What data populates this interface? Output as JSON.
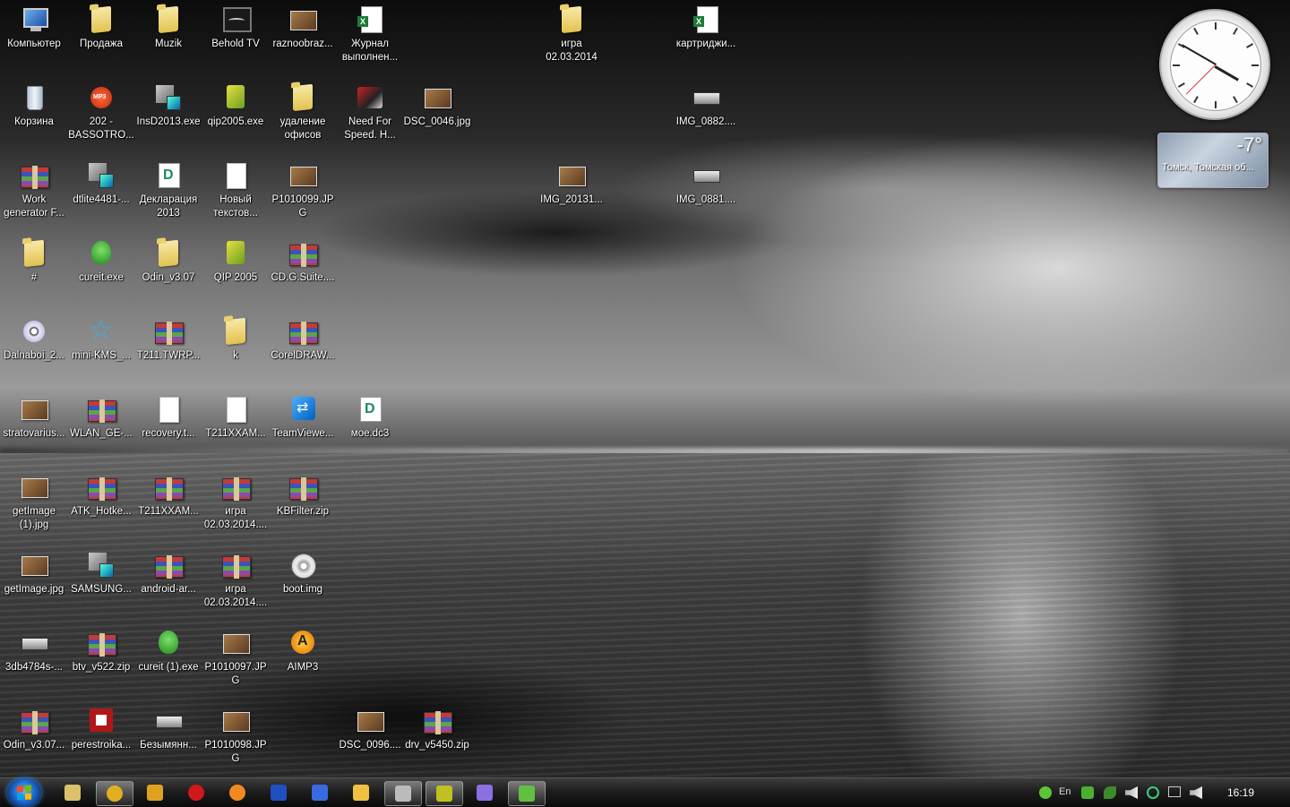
{
  "desktop": {
    "icons": [
      {
        "label": "Компьютер",
        "kind": "computer-icon"
      },
      {
        "label": "Продажа",
        "kind": "folder-icon"
      },
      {
        "label": "Muzik",
        "kind": "folder-icon"
      },
      {
        "label": "Behold TV",
        "kind": "tv-icon"
      },
      {
        "label": "raznoobraz...",
        "kind": "photo-icon"
      },
      {
        "label": "Журнал выполнен...",
        "kind": "excel-icon"
      },
      {
        "label": "игра 02.03.2014",
        "kind": "folder-icon"
      },
      {
        "label": "картриджи...",
        "kind": "excel-icon"
      },
      {
        "label": "Корзина",
        "kind": "recycle-bin-icon"
      },
      {
        "label": "202 - BASSOTRO...",
        "kind": "mp3-icon"
      },
      {
        "label": "InsD2013.exe",
        "kind": "setup-icon"
      },
      {
        "label": "qip2005.exe",
        "kind": "qip-icon"
      },
      {
        "label": "удаление офисов",
        "kind": "folder-icon"
      },
      {
        "label": "Need For Speed. H...",
        "kind": "car-icon"
      },
      {
        "label": "DSC_0046.jpg",
        "kind": "photo-icon"
      },
      {
        "label": "IMG_0882....",
        "kind": "scanner-icon"
      },
      {
        "label": "Work generator F...",
        "kind": "winrar-icon"
      },
      {
        "label": "dtlite4481-...",
        "kind": "setup-icon"
      },
      {
        "label": "Декларация 2013",
        "kind": "declaration-icon"
      },
      {
        "label": "Новый текстов...",
        "kind": "text-document-icon"
      },
      {
        "label": "P1010099.JPG",
        "kind": "photo-icon"
      },
      {
        "label": "IMG_20131...",
        "kind": "photo-icon"
      },
      {
        "label": "IMG_0881....",
        "kind": "scanner-icon"
      },
      {
        "label": "#",
        "kind": "folder-icon"
      },
      {
        "label": "cureit.exe",
        "kind": "cureit-icon"
      },
      {
        "label": "Odin_v3.07",
        "kind": "folder-icon"
      },
      {
        "label": "QIP 2005",
        "kind": "qip-icon"
      },
      {
        "label": "CD.G.Suite....",
        "kind": "winrar-icon"
      },
      {
        "label": "Dalnaboi_2...",
        "kind": "disc-icon"
      },
      {
        "label": "mini-KMS_...",
        "kind": "star-icon"
      },
      {
        "label": "T211.TWRP...",
        "kind": "winrar-icon"
      },
      {
        "label": "k",
        "kind": "folder-icon"
      },
      {
        "label": "CorelDRAW...",
        "kind": "winrar-icon"
      },
      {
        "label": "stratovarius...",
        "kind": "photo-icon"
      },
      {
        "label": "WLAN_GE-...",
        "kind": "winrar-icon"
      },
      {
        "label": "recovery.t...",
        "kind": "text-document-icon"
      },
      {
        "label": "T211XXAM...",
        "kind": "text-document-icon"
      },
      {
        "label": "TeamViewe...",
        "kind": "teamviewer-icon"
      },
      {
        "label": "мое.dc3",
        "kind": "declaration-icon"
      },
      {
        "label": "getImage (1).jpg",
        "kind": "photo-icon"
      },
      {
        "label": "ATK_Hotke...",
        "kind": "winrar-icon"
      },
      {
        "label": "T211XXAM...",
        "kind": "winrar-icon"
      },
      {
        "label": "игра 02.03.2014....",
        "kind": "winrar-icon"
      },
      {
        "label": "KBFilter.zip",
        "kind": "winrar-icon"
      },
      {
        "label": "getImage.jpg",
        "kind": "photo-icon"
      },
      {
        "label": "SAMSUNG...",
        "kind": "setup-icon"
      },
      {
        "label": "android-ar...",
        "kind": "winrar-icon"
      },
      {
        "label": "игра 02.03.2014....",
        "kind": "winrar-icon"
      },
      {
        "label": "boot.img",
        "kind": "cd-icon"
      },
      {
        "label": "3db4784s-...",
        "kind": "scanner-icon"
      },
      {
        "label": "btv_v522.zip",
        "kind": "winrar-icon"
      },
      {
        "label": "cureit (1).exe",
        "kind": "cureit-icon"
      },
      {
        "label": "P1010097.JPG",
        "kind": "photo-icon"
      },
      {
        "label": "AIMP3",
        "kind": "aimp-icon"
      },
      {
        "label": "Odin_v3.07...",
        "kind": "winrar-icon"
      },
      {
        "label": "perestroika...",
        "kind": "red-app-icon"
      },
      {
        "label": "Безымянн...",
        "kind": "scanner-icon"
      },
      {
        "label": "P1010098.JPG",
        "kind": "photo-icon"
      },
      {
        "label": "DSC_0096....",
        "kind": "photo-icon"
      },
      {
        "label": "drv_v5450.zip",
        "kind": "winrar-icon"
      }
    ]
  },
  "gadgets": {
    "weather": {
      "temp": "-7°",
      "location": "Томск, Томская об..."
    }
  },
  "taskbar": {
    "buttons": [
      {
        "name": "explorer-taskbar-button",
        "icon": "folder-icon",
        "color": "#d9c26a"
      },
      {
        "name": "chrome-taskbar-button",
        "icon": "chrome-icon",
        "color": "#e0b020",
        "active": true
      },
      {
        "name": "app-taskbar-button",
        "icon": "triangle-icon",
        "color": "#e0a020"
      },
      {
        "name": "opera-taskbar-button",
        "icon": "opera-icon",
        "color": "#d01818"
      },
      {
        "name": "firefox-taskbar-button",
        "icon": "firefox-icon",
        "color": "#f08a20"
      },
      {
        "name": "floppy-taskbar-button",
        "icon": "floppy-icon",
        "color": "#2050c0"
      },
      {
        "name": "d-app-taskbar-button",
        "icon": "d-icon",
        "color": "#3a6ae0"
      },
      {
        "name": "clock-app-taskbar-button",
        "icon": "clock-icon",
        "color": "#f0c040"
      },
      {
        "name": "printer-taskbar-button",
        "icon": "printer-icon",
        "color": "#bbbbbb",
        "active": true
      },
      {
        "name": "qip-taskbar-button",
        "icon": "qip-icon",
        "color": "#c0c020",
        "active": true
      },
      {
        "name": "vs-taskbar-button",
        "icon": "bowtie-icon",
        "color": "#8a70e0"
      },
      {
        "name": "utorrent-taskbar-button",
        "icon": "utorrent-icon",
        "color": "#60c040",
        "active": true
      }
    ],
    "tray": {
      "language": "En",
      "time": "16:19"
    }
  }
}
